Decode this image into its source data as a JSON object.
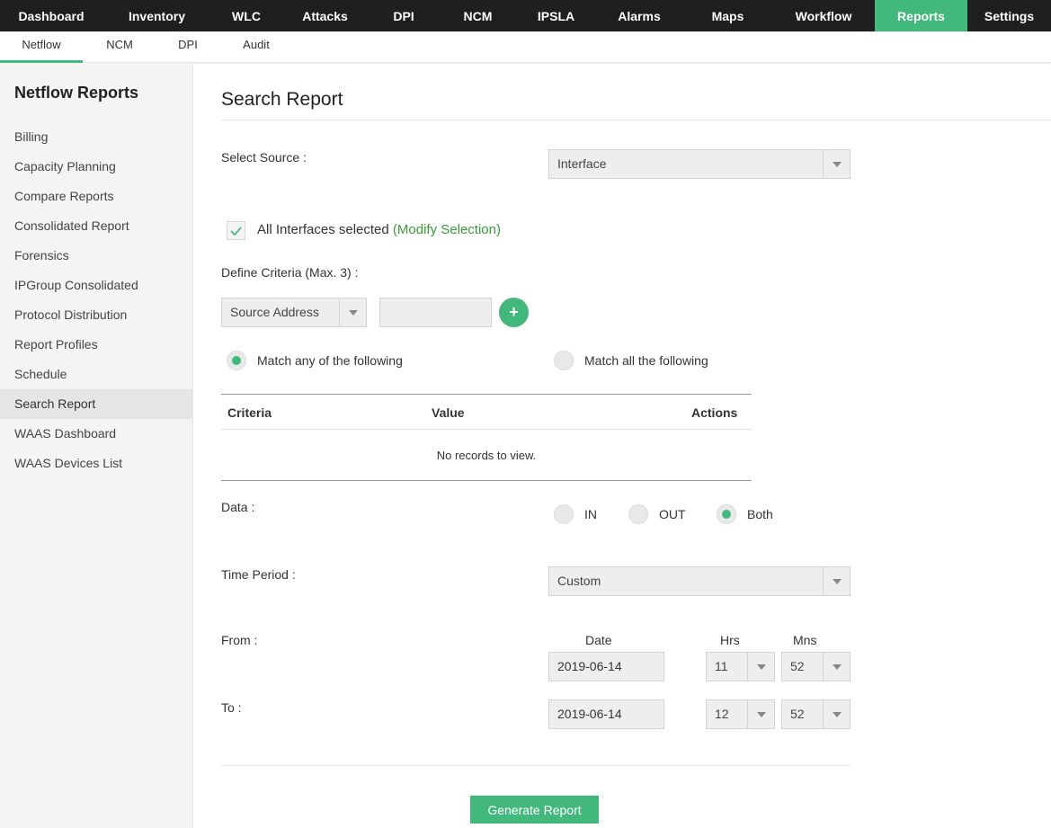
{
  "topnav": {
    "tabs": [
      "Dashboard",
      "Inventory",
      "WLC",
      "Attacks",
      "DPI",
      "NCM",
      "IPSLA",
      "Alarms",
      "Maps",
      "Workflow",
      "Reports",
      "Settings"
    ],
    "active": "Reports"
  },
  "subnav": {
    "tabs": [
      "Netflow",
      "NCM",
      "DPI",
      "Audit"
    ],
    "active": "Netflow"
  },
  "sidebar": {
    "title": "Netflow Reports",
    "items": [
      "Billing",
      "Capacity Planning",
      "Compare Reports",
      "Consolidated Report",
      "Forensics",
      "IPGroup Consolidated",
      "Protocol Distribution",
      "Report Profiles",
      "Schedule",
      "Search Report",
      "WAAS Dashboard",
      "WAAS Devices List"
    ],
    "active": "Search Report"
  },
  "main": {
    "title": "Search Report",
    "select_source_label": "Select Source :",
    "select_source_value": "Interface",
    "all_interfaces_text": "All Interfaces selected",
    "all_interfaces_checked": true,
    "modify_selection": "(Modify Selection)",
    "define_criteria_label": "Define Criteria (Max. 3) :",
    "criteria_select_value": "Source Address",
    "criteria_input_value": "",
    "add_label": "+",
    "match_any_label": "Match any of the following",
    "match_all_label": "Match all the following",
    "match_selected": "any",
    "grid": {
      "columns": [
        "Criteria",
        "Value",
        "Actions"
      ],
      "empty_text": "No records to view."
    },
    "data_label": "Data :",
    "data_options": [
      "IN",
      "OUT",
      "Both"
    ],
    "data_selected": "Both",
    "time_period_label": "Time Period :",
    "time_period_value": "Custom",
    "col_date": "Date",
    "col_hrs": "Hrs",
    "col_mns": "Mns",
    "from_label": "From :",
    "from_date": "2019-06-14",
    "from_hrs": "11",
    "from_mns": "52",
    "to_label": "To :",
    "to_date": "2019-06-14",
    "to_hrs": "12",
    "to_mns": "52",
    "generate_button": "Generate Report"
  },
  "colors": {
    "accent": "#43b87c",
    "link_green": "#3a9b3a",
    "topbar": "#1f1f1f"
  }
}
